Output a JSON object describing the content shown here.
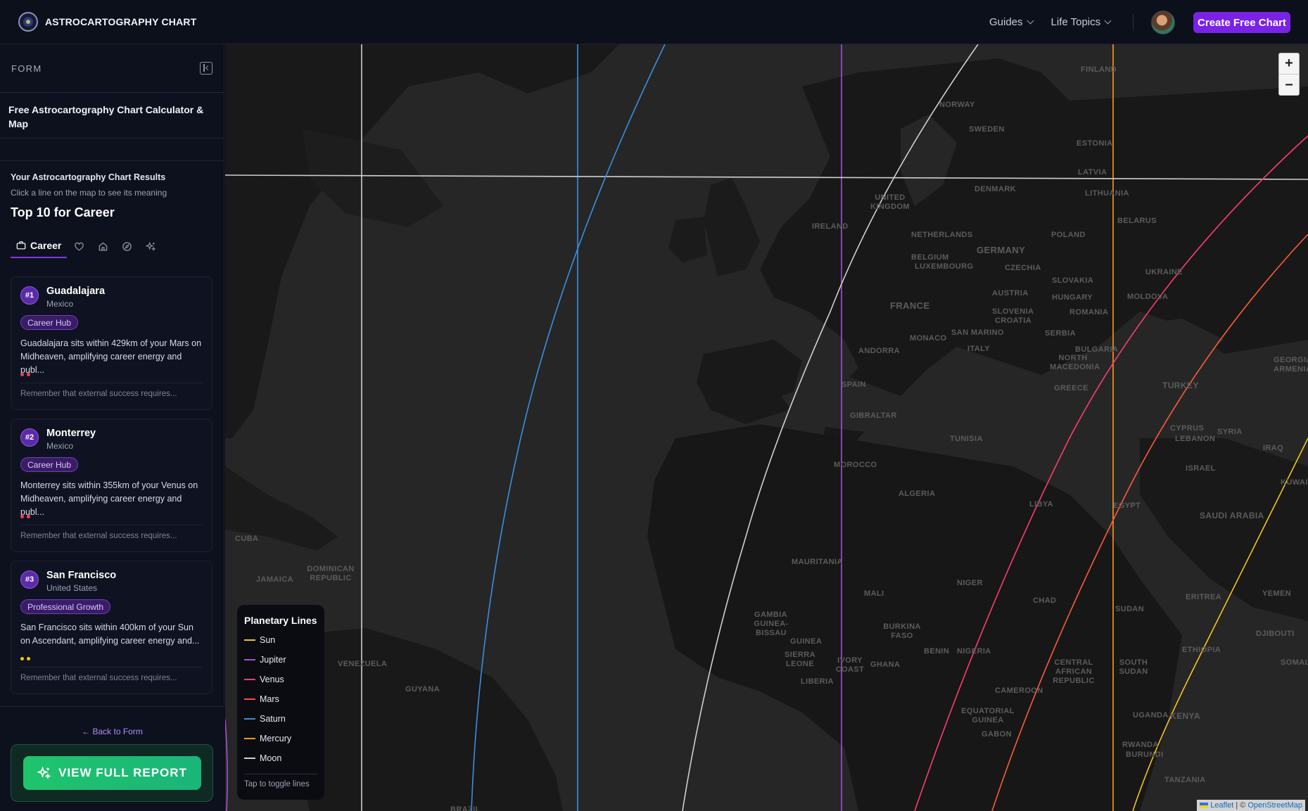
{
  "header": {
    "brand": "ASTROCARTOGRAPHY CHART",
    "nav": [
      {
        "label": "Guides"
      },
      {
        "label": "Life Topics"
      }
    ],
    "cta": "Create Free Chart"
  },
  "sidebar": {
    "section_label": "FORM",
    "title": "Free Astrocartography Chart Calculator & Map",
    "results_label": "Your Astrocartography Chart Results",
    "results_hint": "Click a line on the map to see its meaning",
    "results_heading": "Top 10 for Career",
    "tabs": [
      {
        "label": "Career",
        "icon": "briefcase-icon",
        "active": true
      },
      {
        "label": "",
        "icon": "heart-icon"
      },
      {
        "label": "",
        "icon": "home-icon"
      },
      {
        "label": "",
        "icon": "compass-icon"
      },
      {
        "label": "",
        "icon": "sparkles-icon"
      }
    ],
    "cards": [
      {
        "rank": "#1",
        "city": "Guadalajara",
        "country": "Mexico",
        "tag": "Career Hub",
        "desc": "Guadalajara sits within 429km of your Mars on Midheaven, amplifying career energy and publ...",
        "dot_color": "#ff3b5c",
        "advice": "Remember that external success requires..."
      },
      {
        "rank": "#2",
        "city": "Monterrey",
        "country": "Mexico",
        "tag": "Career Hub",
        "desc": "Monterrey sits within 355km of your Venus on Midheaven, amplifying career energy and publ...",
        "dot_color": "#ff3b5c",
        "advice": "Remember that external success requires..."
      },
      {
        "rank": "#3",
        "city": "San Francisco",
        "country": "United States",
        "tag": "Professional Growth",
        "desc": "San Francisco sits within 400km of your Sun on Ascendant, amplifying career energy and...",
        "dot_color": "#f5c518",
        "advice": "Remember that external success requires..."
      }
    ],
    "back_link": "← Back to Form",
    "report_button": "VIEW FULL REPORT"
  },
  "map": {
    "zoom_in": "+",
    "zoom_out": "−",
    "labels": [
      "NORWAY",
      "SWEDEN",
      "FINLAND",
      "ESTONIA",
      "LATVIA",
      "LITHUANIA",
      "DENMARK",
      "UNITED KINGDOM",
      "IRELAND",
      "NETHERLANDS",
      "BELGIUM",
      "LUXEMBOURG",
      "GERMANY",
      "POLAND",
      "BELARUS",
      "UKRAINE",
      "CZECHIA",
      "SLOVAKIA",
      "AUSTRIA",
      "HUNGARY",
      "MOLDOVA",
      "SLOVENIA",
      "CROATIA",
      "ROMANIA",
      "FRANCE",
      "MONACO",
      "SAN MARINO",
      "ITALY",
      "SERBIA",
      "BULGARIA",
      "NORTH MACEDONIA",
      "ANDORRA",
      "SPAIN",
      "GREECE",
      "TURKEY",
      "GEORGIA",
      "ARMENIA",
      "GIBRALTAR",
      "TUNISIA",
      "CYPRUS",
      "LEBANON",
      "SYRIA",
      "IRAQ",
      "ISRAEL",
      "KUWAIT",
      "MOROCCO",
      "ALGERIA",
      "LIBYA",
      "EGYPT",
      "SAUDI ARABIA",
      "MAURITANIA",
      "MALI",
      "NIGER",
      "CHAD",
      "SUDAN",
      "ERITREA",
      "YEMEN",
      "DJIBOUTI",
      "SOMALIA",
      "ETHIOPIA",
      "BURKINA FASO",
      "GAMBIA",
      "GUINEA-BISSAU",
      "GUINEA",
      "SIERRA LEONE",
      "LIBERIA",
      "IVORY COAST",
      "GHANA",
      "BENIN",
      "NIGERIA",
      "CAMEROON",
      "CENTRAL AFRICAN REPUBLIC",
      "SOUTH SUDAN",
      "EQUATORIAL GUINEA",
      "GABON",
      "UGANDA",
      "KENYA",
      "RWANDA",
      "BURUNDI",
      "TANZANIA",
      "CUBA",
      "JAMAICA",
      "DOMINICAN REPUBLIC",
      "VENEZUELA",
      "GUYANA",
      "BRAZIL"
    ],
    "legend": {
      "title": "Planetary Lines",
      "items": [
        {
          "name": "Sun",
          "color": "#f5c518"
        },
        {
          "name": "Jupiter",
          "color": "#a94fd6"
        },
        {
          "name": "Venus",
          "color": "#ff3b6b"
        },
        {
          "name": "Mars",
          "color": "#ff4a3a"
        },
        {
          "name": "Saturn",
          "color": "#3a8fe0"
        },
        {
          "name": "Mercury",
          "color": "#ff9a1f"
        },
        {
          "name": "Moon",
          "color": "#d0d0d0"
        }
      ],
      "note": "Tap to toggle lines"
    },
    "attribution": {
      "leaflet": "Leaflet",
      "sep": "| ©",
      "osm": "OpenStreetMap"
    }
  }
}
